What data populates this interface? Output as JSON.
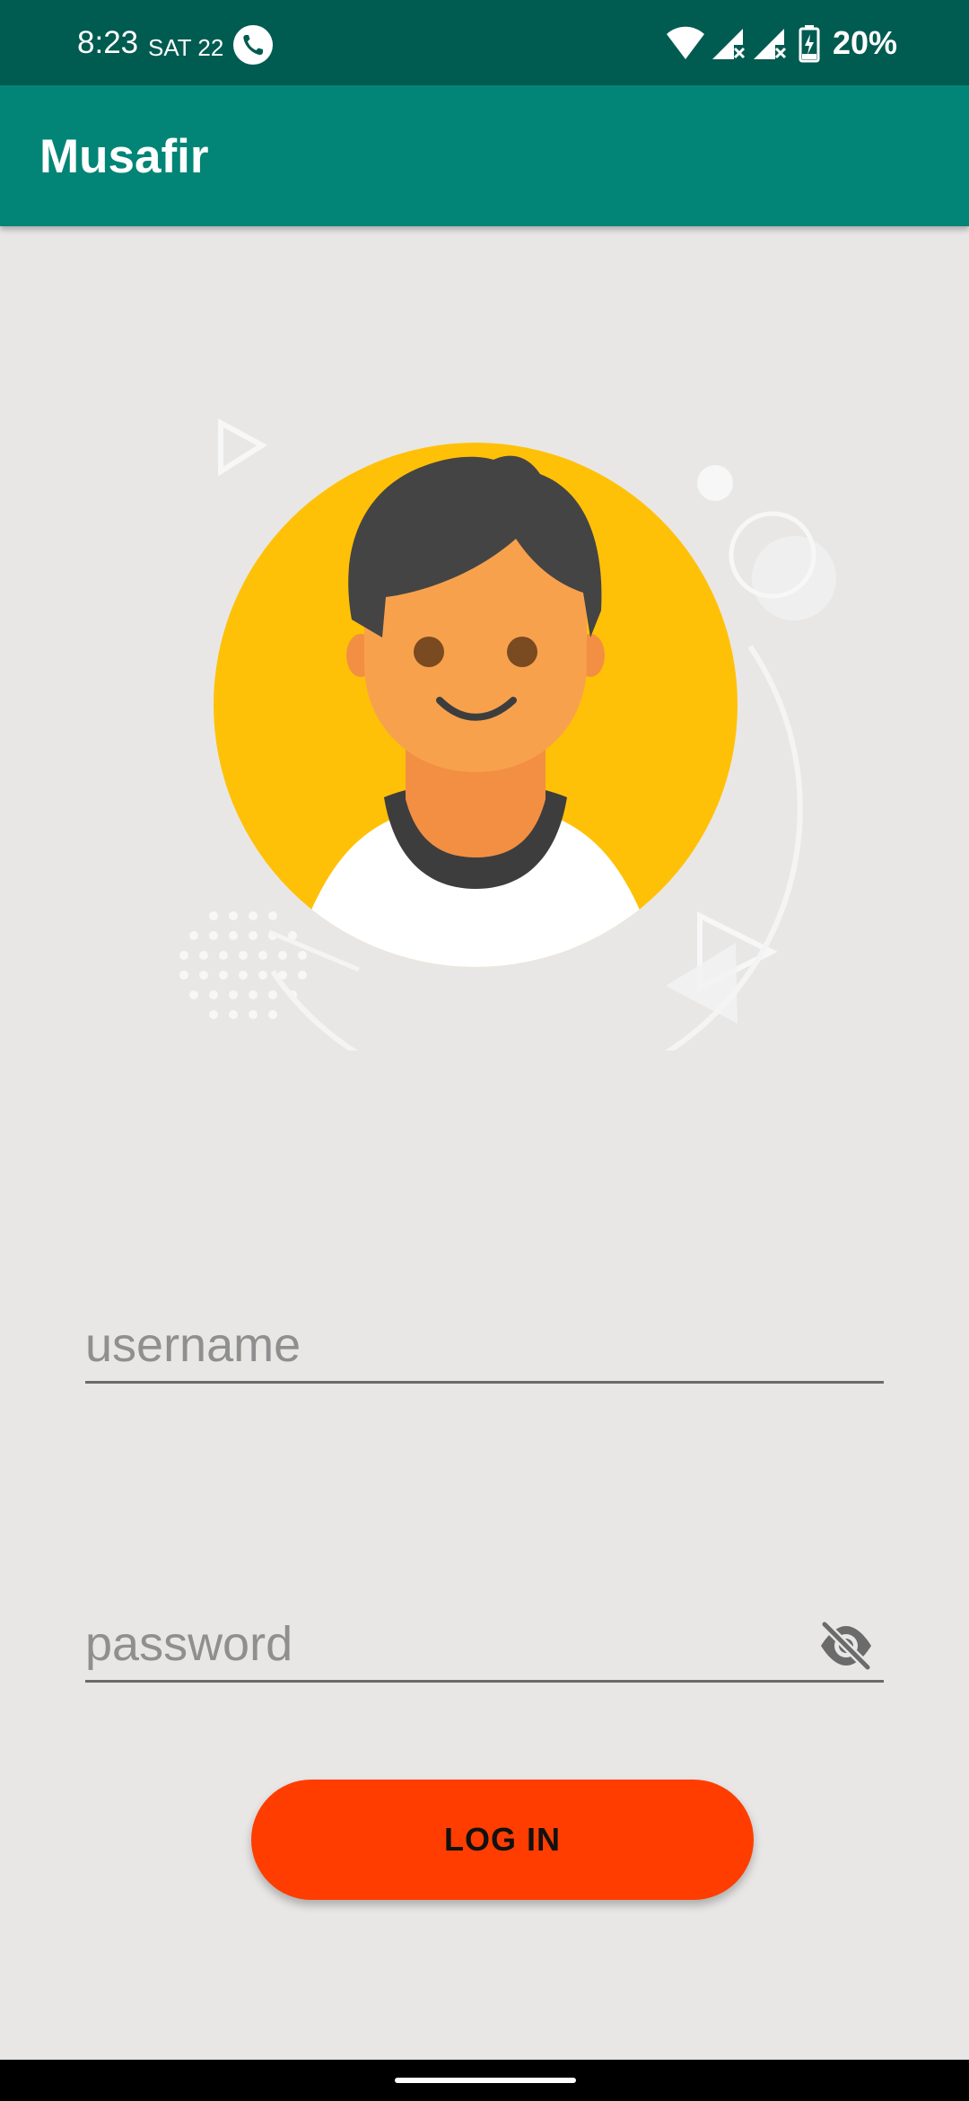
{
  "status_bar": {
    "time": "8:23",
    "date": "SAT 22",
    "battery_percent": "20%",
    "icons": [
      "phone-call-icon",
      "wifi-icon",
      "signal-no-data-icon",
      "signal-no-data-icon",
      "battery-charging-icon"
    ]
  },
  "app_bar": {
    "title": "Musafir"
  },
  "login": {
    "avatar": "user-avatar-illustration",
    "username_placeholder": "username",
    "password_placeholder": "password",
    "password_toggle_icon": "eye-off-icon",
    "button_label": "LOG IN"
  },
  "colors": {
    "status_bar": "#005b50",
    "app_bar": "#028576",
    "background": "#e8e7e6",
    "accent_button": "#ff3d00",
    "avatar_circle": "#ffc107"
  }
}
